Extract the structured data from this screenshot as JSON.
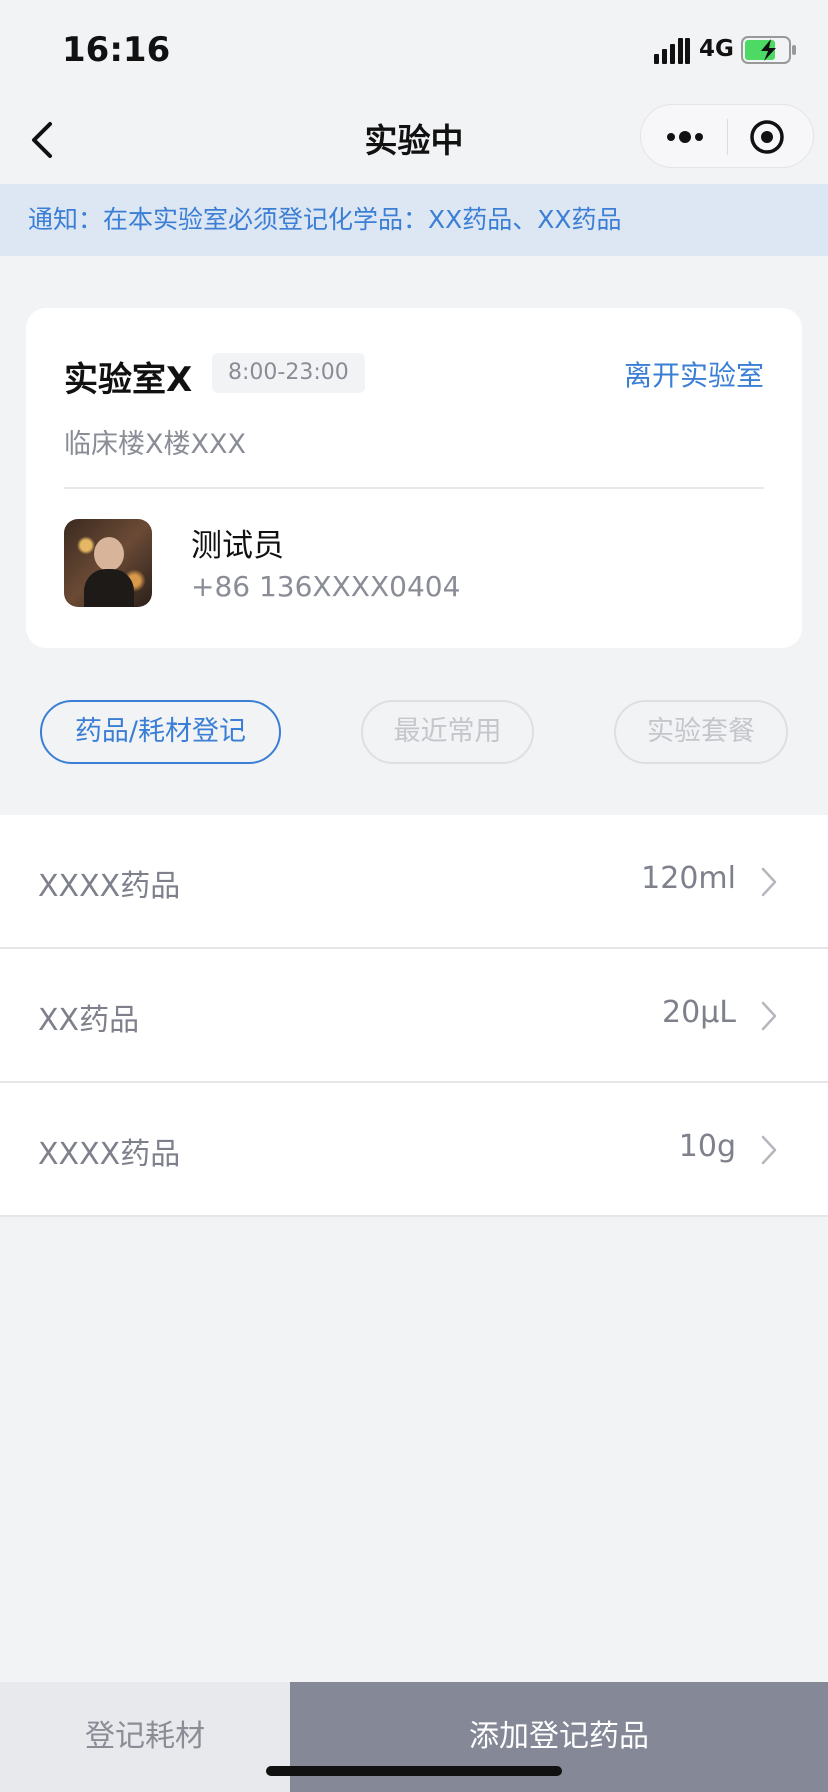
{
  "status_bar": {
    "time": "16:16",
    "network": "4G",
    "icons": [
      "signal-icon",
      "battery-charging-icon"
    ]
  },
  "nav": {
    "title": "实验中",
    "icons": [
      "back-icon",
      "more-icon",
      "target-icon"
    ]
  },
  "notice": {
    "text": "通知：在本实验室必须登记化学品：XX药品、XX药品"
  },
  "lab": {
    "name": "实验室X",
    "hours": "8:00-23:00",
    "leave_label": "离开实验室",
    "location": "临床楼X楼XXX"
  },
  "user": {
    "name": "测试员",
    "phone": "+86 136XXXX0404"
  },
  "tabs": [
    {
      "label": "药品/耗材登记",
      "active": true
    },
    {
      "label": "最近常用",
      "active": false
    },
    {
      "label": "实验套餐",
      "active": false
    }
  ],
  "drugs": [
    {
      "name": "XXXX药品",
      "amount": "120ml"
    },
    {
      "name": "XX药品",
      "amount": "20μL"
    },
    {
      "name": "XXXX药品",
      "amount": "10g"
    }
  ],
  "bottom": {
    "register_consumables": "登记耗材",
    "add_drug": "添加登记药品"
  },
  "colors": {
    "accent": "#3a7fd5",
    "notice_bg": "#dde6f3",
    "primary_button_bg": "#858897",
    "battery_green": "#4cd964"
  }
}
